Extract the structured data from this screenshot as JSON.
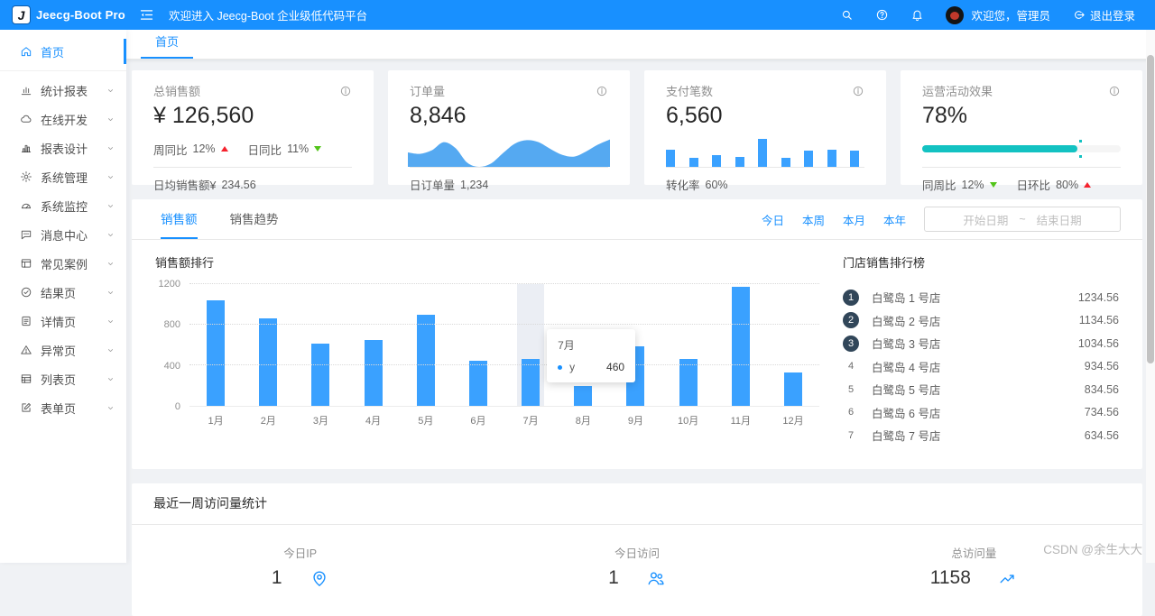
{
  "header": {
    "logo_letter": "J",
    "logo_text": "Jeecg-Boot Pro",
    "welcome_text": "欢迎进入 Jeecg-Boot 企业级低代码平台",
    "user_greeting": "欢迎您，管理员",
    "logout_label": "退出登录"
  },
  "tab_bar": {
    "active_tab": "首页"
  },
  "sidebar": {
    "items": [
      {
        "label": "首页",
        "icon": "home-icon",
        "active": true,
        "has_children": false
      },
      {
        "label": "统计报表",
        "icon": "stats-icon",
        "active": false,
        "has_children": true
      },
      {
        "label": "在线开发",
        "icon": "cloud-icon",
        "active": false,
        "has_children": true
      },
      {
        "label": "报表设计",
        "icon": "report-icon",
        "active": false,
        "has_children": true
      },
      {
        "label": "系统管理",
        "icon": "gear-icon",
        "active": false,
        "has_children": true
      },
      {
        "label": "系统监控",
        "icon": "monitor-icon",
        "active": false,
        "has_children": true
      },
      {
        "label": "消息中心",
        "icon": "message-icon",
        "active": false,
        "has_children": true
      },
      {
        "label": "常见案例",
        "icon": "case-icon",
        "active": false,
        "has_children": true
      },
      {
        "label": "结果页",
        "icon": "result-icon",
        "active": false,
        "has_children": true
      },
      {
        "label": "详情页",
        "icon": "detail-icon",
        "active": false,
        "has_children": true
      },
      {
        "label": "异常页",
        "icon": "exception-icon",
        "active": false,
        "has_children": true
      },
      {
        "label": "列表页",
        "icon": "list-icon",
        "active": false,
        "has_children": true
      },
      {
        "label": "表单页",
        "icon": "form-icon",
        "active": false,
        "has_children": true
      }
    ]
  },
  "cards": {
    "total_sales": {
      "title": "总销售额",
      "value": "¥ 126,560",
      "week_label": "周同比",
      "week_value": "12%",
      "week_trend": "up",
      "day_label": "日同比",
      "day_value": "11%",
      "day_trend": "down",
      "footer_label": "日均销售额¥",
      "footer_value": "234.56"
    },
    "orders": {
      "title": "订单量",
      "value": "8,846",
      "footer_label": "日订单量",
      "footer_value": "1,234"
    },
    "payments": {
      "title": "支付笔数",
      "value": "6,560",
      "footer_label": "转化率",
      "footer_value": "60%"
    },
    "activity": {
      "title": "运营活动效果",
      "value": "78%",
      "progress_percent": 78,
      "week_label": "同周比",
      "week_value": "12%",
      "week_trend": "down",
      "day_label": "日环比",
      "day_value": "80%",
      "day_trend": "up"
    }
  },
  "sales_panel": {
    "tabs": [
      {
        "label": "销售额",
        "active": true
      },
      {
        "label": "销售趋势",
        "active": false
      }
    ],
    "quick_links": [
      "今日",
      "本周",
      "本月",
      "本年"
    ],
    "date_picker": {
      "start_placeholder": "开始日期",
      "separator": "~",
      "end_placeholder": "结束日期"
    },
    "ranking": {
      "title": "门店销售排行榜",
      "items": [
        {
          "rank": "1",
          "name": "白鹭岛 1 号店",
          "value": "1234.56"
        },
        {
          "rank": "2",
          "name": "白鹭岛 2 号店",
          "value": "1134.56"
        },
        {
          "rank": "3",
          "name": "白鹭岛 3 号店",
          "value": "1034.56"
        },
        {
          "rank": "4",
          "name": "白鹭岛 4 号店",
          "value": "934.56"
        },
        {
          "rank": "5",
          "name": "白鹭岛 5 号店",
          "value": "834.56"
        },
        {
          "rank": "6",
          "name": "白鹭岛 6 号店",
          "value": "734.56"
        },
        {
          "rank": "7",
          "name": "白鹭岛 7 号店",
          "value": "634.56"
        }
      ]
    }
  },
  "visits_panel": {
    "title": "最近一周访问量统计",
    "stats": [
      {
        "label": "今日IP",
        "value": "1",
        "icon": "location-icon"
      },
      {
        "label": "今日访问",
        "value": "1",
        "icon": "team-icon"
      },
      {
        "label": "总访问量",
        "value": "1158",
        "icon": "rise-icon"
      }
    ]
  },
  "watermark": "CSDN @余生大大",
  "colors": {
    "header_primary": "#1890ff",
    "bar_blue": "#3aa1ff",
    "area_blue": "#55a9f1",
    "progress_teal": "#13c2c2",
    "trend_up_red": "#f5222d",
    "trend_down_green": "#52c41a",
    "rank_badge_dark": "#314659"
  },
  "chart_data": [
    {
      "id": "sales_rank",
      "type": "bar",
      "title": "销售额排行",
      "categories": [
        "1月",
        "2月",
        "3月",
        "4月",
        "5月",
        "6月",
        "7月",
        "8月",
        "9月",
        "10月",
        "11月",
        "12月"
      ],
      "values": [
        1040,
        860,
        615,
        650,
        900,
        445,
        460,
        200,
        590,
        465,
        1170,
        330
      ],
      "xlabel": "",
      "ylabel": "",
      "ylim": [
        0,
        1200
      ],
      "yticks": [
        0,
        400,
        800,
        1200
      ],
      "grid": "dotted-horizontal",
      "legend": "none",
      "highlighted_category": "7月",
      "tooltip": {
        "title": "7月",
        "series": "y",
        "value": "460"
      }
    },
    {
      "id": "orders_spark",
      "type": "area",
      "values": [
        42,
        38,
        48,
        72,
        55,
        12,
        0,
        10,
        40,
        68,
        78,
        72,
        52,
        35,
        30,
        45,
        65,
        80
      ],
      "ylim": [
        0,
        100
      ]
    },
    {
      "id": "payments_spark",
      "type": "bar",
      "values": [
        57,
        30,
        37,
        33,
        90,
        30,
        53,
        57,
        53
      ],
      "ylim": [
        0,
        100
      ]
    }
  ]
}
